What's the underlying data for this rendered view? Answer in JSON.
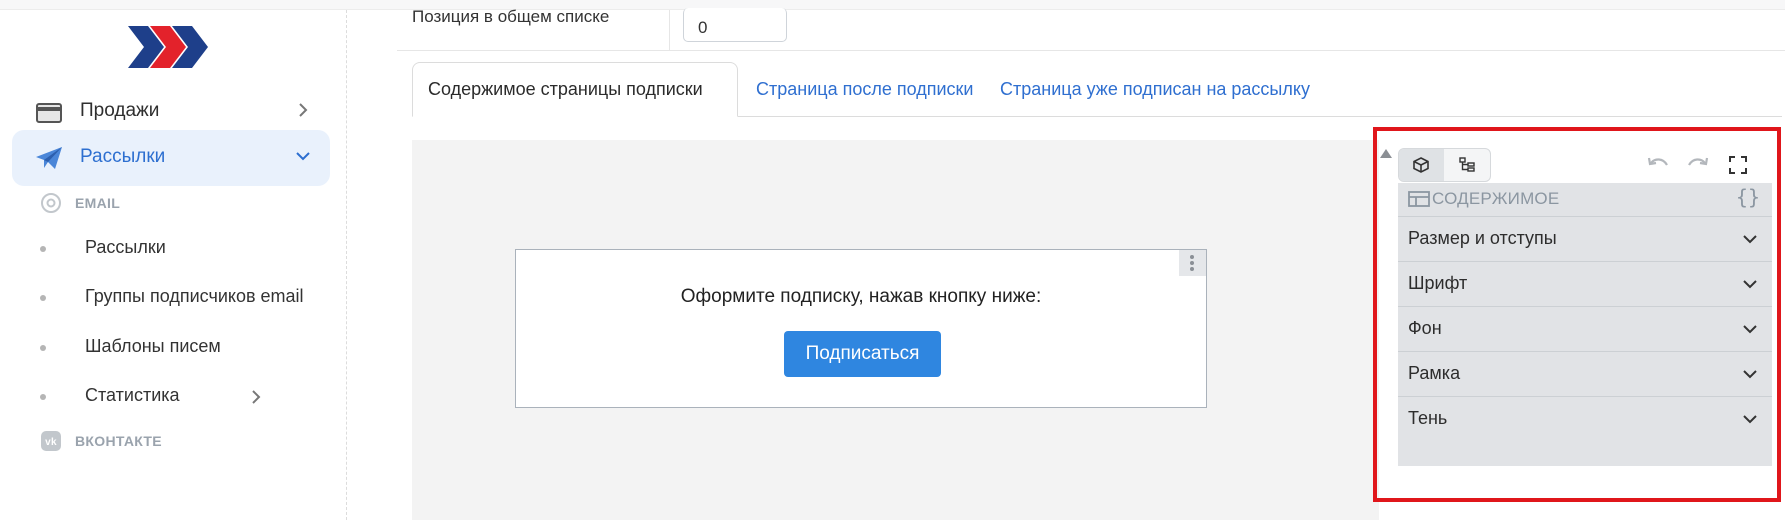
{
  "sidebar": {
    "items": [
      {
        "label": "Продажи",
        "icon": "card-icon"
      },
      {
        "label": "Рассылки",
        "icon": "paper-plane-icon",
        "active": true
      }
    ],
    "email_group": {
      "label": "EMAIL",
      "items": [
        {
          "label": "Рассылки"
        },
        {
          "label": "Группы подписчиков email"
        },
        {
          "label": "Шаблоны писем"
        },
        {
          "label": "Статистика"
        }
      ]
    },
    "vk_group": {
      "label": "ВКОНТАКТЕ"
    }
  },
  "position": {
    "label": "Позиция в общем списке",
    "value": "0"
  },
  "tabs": [
    {
      "label": "Содержимое страницы подписки",
      "active": true
    },
    {
      "label": "Страница после подписки"
    },
    {
      "label": "Страница уже подписан на рассылку"
    }
  ],
  "canvas": {
    "text": "Оформите подписку, нажав кнопку ниже:",
    "button": "Подписаться"
  },
  "editor": {
    "section_title": "СОДЕРЖИМОЕ",
    "braces": "{}",
    "sections": [
      {
        "label": "Размер и отступы"
      },
      {
        "label": "Шрифт"
      },
      {
        "label": "Фон"
      },
      {
        "label": "Рамка"
      },
      {
        "label": "Тень"
      }
    ]
  },
  "colors": {
    "accent": "#2f6fd0",
    "button": "#2f86e0",
    "highlight": "#e0161b",
    "active_nav_bg": "#e9f1fc"
  }
}
